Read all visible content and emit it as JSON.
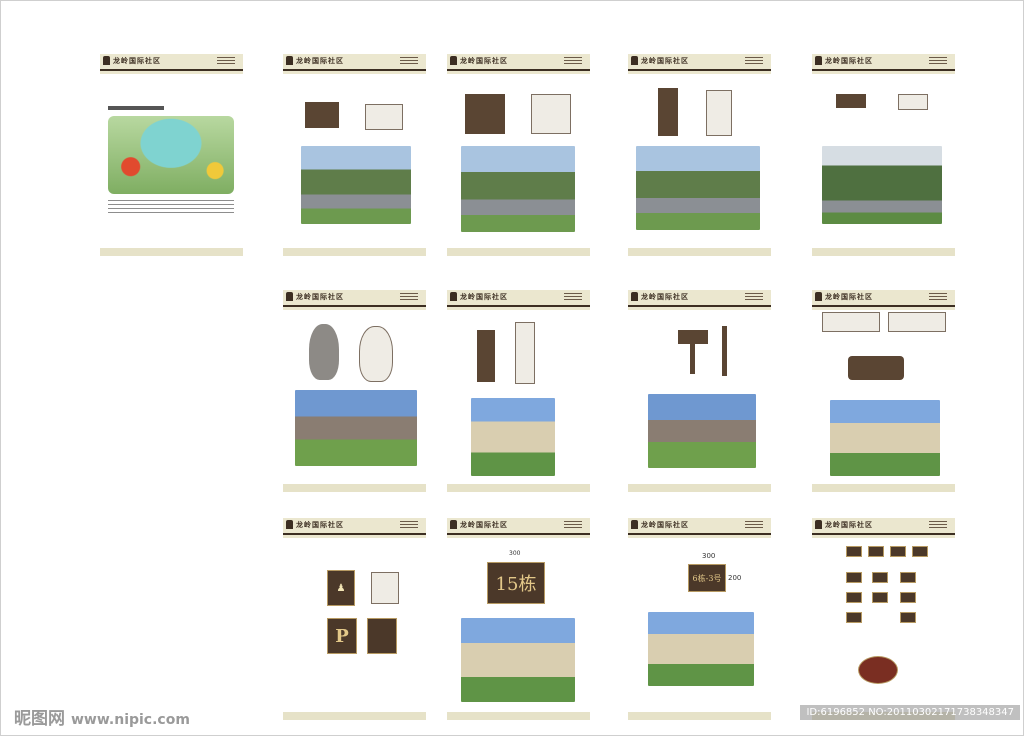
{
  "header": {
    "logo_text": "龙岭国际社区"
  },
  "plaques": {
    "building_number": "15栋",
    "house_number": "6栋-3号",
    "parking_letter": "P"
  },
  "dimensions": {
    "plaque_width": "300",
    "plaque_height": "200"
  },
  "watermark": {
    "site": "昵图网",
    "url": "www.nipic.com"
  },
  "image_id": "ID:6196852 NO:20110302171738348347"
}
